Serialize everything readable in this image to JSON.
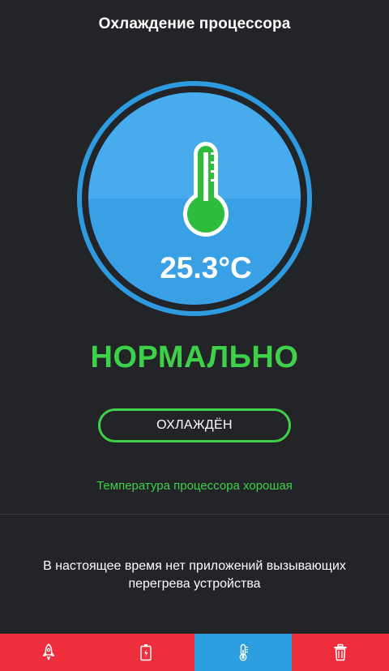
{
  "header": {
    "title": "Охлаждение процессора"
  },
  "gauge": {
    "icon": "thermometer-icon",
    "temperature": "25.3°C",
    "colors": {
      "ring": "#2e9ae0",
      "face": "#39a0e6",
      "thermometer": "#2ebd3b"
    }
  },
  "status": {
    "label": "НОРМАЛЬНО",
    "color": "#3fd04a"
  },
  "actions": {
    "cool_button_label": "ОХЛАЖДЁН"
  },
  "info": {
    "message": "Температура процессора хорошая"
  },
  "apps": {
    "message": "В настоящее время нет приложений вызывающих перегрева устройства"
  },
  "bottom_nav": {
    "tabs": [
      {
        "icon": "rocket-icon",
        "active": false
      },
      {
        "icon": "battery-icon",
        "active": false
      },
      {
        "icon": "thermometer-icon",
        "active": true
      },
      {
        "icon": "trash-icon",
        "active": false
      }
    ],
    "colors": {
      "background": "#ee2e3d",
      "active": "#2d9fe0"
    }
  }
}
